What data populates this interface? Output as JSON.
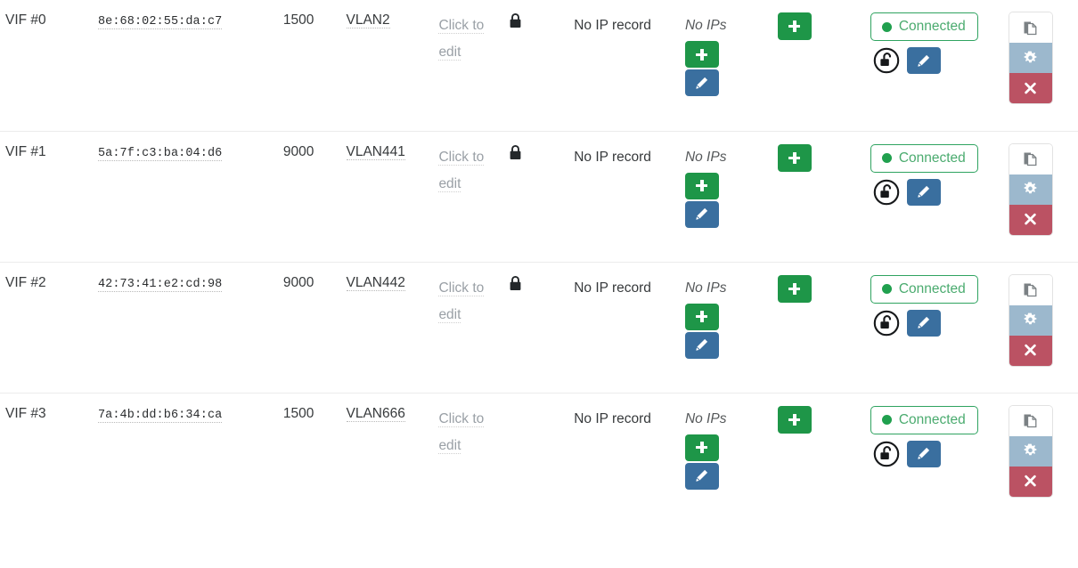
{
  "table": {
    "columns": [
      "device",
      "mac_address",
      "mtu",
      "network",
      "edit_hint",
      "locked",
      "ip_record",
      "ips",
      "add_ip",
      "status",
      "actions"
    ],
    "rows": [
      {
        "device": "VIF #0",
        "mac_address": "8e:68:02:55:da:c7",
        "mtu": "1500",
        "network": "VLAN2",
        "edit_hint": "Click to edit",
        "locked_icon": "lock-icon",
        "locked": true,
        "ip_record": "No IP record",
        "ips": "No IPs",
        "status_text": "Connected",
        "status_color": "#4bab6f",
        "lock_state_icon": "unlock-circle-icon"
      },
      {
        "device": "VIF #1",
        "mac_address": "5a:7f:c3:ba:04:d6",
        "mtu": "9000",
        "network": "VLAN441",
        "edit_hint": "Click to edit",
        "locked_icon": "lock-icon",
        "locked": true,
        "ip_record": "No IP record",
        "ips": "No IPs",
        "status_text": "Connected",
        "status_color": "#4bab6f",
        "lock_state_icon": "unlock-circle-icon"
      },
      {
        "device": "VIF #2",
        "mac_address": "42:73:41:e2:cd:98",
        "mtu": "9000",
        "network": "VLAN442",
        "edit_hint": "Click to edit",
        "locked_icon": "lock-icon",
        "locked": true,
        "ip_record": "No IP record",
        "ips": "No IPs",
        "status_text": "Connected",
        "status_color": "#4bab6f",
        "lock_state_icon": "unlock-circle-icon"
      },
      {
        "device": "VIF #3",
        "mac_address": "7a:4b:dd:b6:34:ca",
        "mtu": "1500",
        "network": "VLAN666",
        "edit_hint": "Click to edit",
        "locked_icon": "",
        "locked": false,
        "ip_record": "No IP record",
        "ips": "No IPs",
        "status_text": "Connected",
        "status_color": "#4bab6f",
        "lock_state_icon": "unlock-circle-icon"
      }
    ]
  },
  "icons": {
    "add": "plus-icon",
    "edit": "pencil-icon",
    "copy": "copy-icon",
    "settings": "gear-icon",
    "delete": "x-icon",
    "lock": "lock-icon",
    "unlock": "unlock-circle-icon"
  },
  "colors": {
    "add_green": "#1e9648",
    "edit_blue": "#3a6f9f",
    "status_green": "#4bab6f",
    "status_dot_green": "#20a04e",
    "gear_blue": "#9cb8cd",
    "delete_red": "#bb5263",
    "divider": "#ececec"
  }
}
